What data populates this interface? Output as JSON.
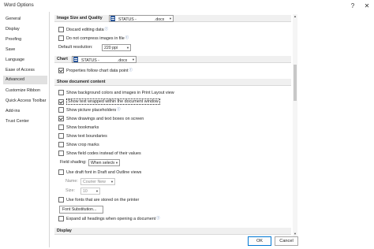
{
  "window": {
    "title": "Word Options",
    "help_glyph": "?",
    "close_glyph": "✕"
  },
  "nav": {
    "items": [
      {
        "label": "General"
      },
      {
        "label": "Display"
      },
      {
        "label": "Proofing"
      },
      {
        "label": "Save"
      },
      {
        "label": "Language"
      },
      {
        "label": "Ease of Access"
      },
      {
        "label": "Advanced",
        "selected": true
      },
      {
        "label": "Customize Ribbon"
      },
      {
        "label": "Quick Access Toolbar"
      },
      {
        "label": "Add-ins"
      },
      {
        "label": "Trust Center"
      }
    ]
  },
  "image_size": {
    "heading": "Image Size and Quality",
    "doc_prefix": "STATUS -",
    "doc_suffix": ".docx",
    "discard_editing": {
      "label": "Discard editing data",
      "checked": false
    },
    "no_compress": {
      "label": "Do not compress images in file",
      "checked": false
    },
    "default_resolution": {
      "label": "Default resolution:",
      "value": "220 ppi"
    }
  },
  "chart": {
    "heading": "Chart",
    "doc_prefix": "STATUS -",
    "doc_suffix": ".docx",
    "properties_follow": {
      "label": "Properties follow chart data point",
      "checked": true
    }
  },
  "show_doc": {
    "heading": "Show document content",
    "options": [
      {
        "label": "Show background colors and images in Print Layout view",
        "checked": false
      },
      {
        "label": "Show text wrapped within the document window",
        "checked": true
      },
      {
        "label": "Show picture placeholders",
        "checked": false
      },
      {
        "label": "Show drawings and text boxes on screen",
        "checked": true
      },
      {
        "label": "Show bookmarks",
        "checked": false
      },
      {
        "label": "Show text boundaries",
        "checked": false
      },
      {
        "label": "Show crop marks",
        "checked": false
      },
      {
        "label": "Show field codes instead of their values",
        "checked": false
      }
    ],
    "field_shading": {
      "label": "Field shading:",
      "value": "When selected"
    },
    "draft_font": {
      "label": "Use draft font in Draft and Outline views",
      "checked": false
    },
    "name": {
      "label": "Name:",
      "value": "Courier New"
    },
    "size": {
      "label": "Size:",
      "value": "10"
    },
    "printer_fonts": {
      "label": "Use fonts that are stored on the printer",
      "checked": false
    },
    "font_substitution": "Font Substitution...",
    "expand_headings": {
      "label": "Expand all headings when opening a document",
      "checked": false
    }
  },
  "display_section": {
    "heading": "Display"
  },
  "footer": {
    "ok": "OK",
    "cancel": "Cancel"
  },
  "colors": {
    "accent": "#2b579a",
    "selected_nav": "#e1e1e1",
    "ok_border": "#0078d4"
  }
}
